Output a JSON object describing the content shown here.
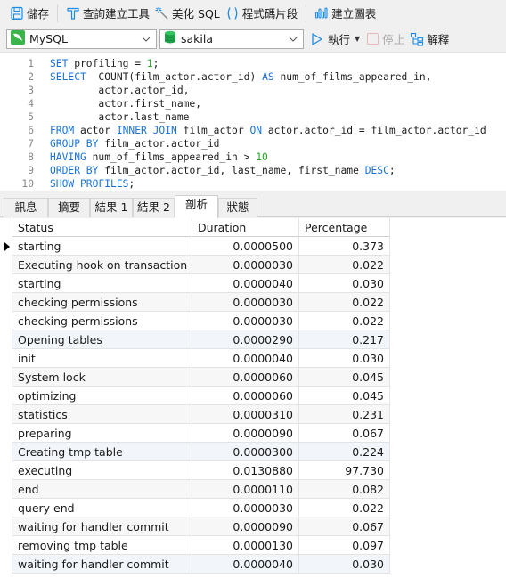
{
  "toolbar": {
    "save": {
      "label": "儲存",
      "icon": "floppy-disk-icon"
    },
    "query_builder": {
      "label": "查詢建立工具",
      "icon": "hammer-icon"
    },
    "beautify": {
      "label": "美化 SQL",
      "icon": "magic-wand-icon"
    },
    "snippet": {
      "label": "程式碼片段",
      "icon": "parentheses-icon"
    },
    "chart": {
      "label": "建立圖表",
      "icon": "chart-bars-icon"
    }
  },
  "toolbar2": {
    "connection": {
      "value": "MySQL",
      "icon": "mysql-dolphin-icon"
    },
    "database": {
      "value": "sakila",
      "icon": "database-icon"
    },
    "run": {
      "label": "執行",
      "icon": "play-icon"
    },
    "stop": {
      "label": "停止",
      "icon": "stop-icon"
    },
    "explain": {
      "label": "解釋",
      "icon": "explain-icon"
    }
  },
  "editor": {
    "lines": [
      {
        "n": "1",
        "tokens": [
          {
            "t": "SET",
            "k": "kw"
          },
          {
            "t": " profiling = "
          },
          {
            "t": "1",
            "k": "num"
          },
          {
            "t": ";"
          }
        ]
      },
      {
        "n": "2",
        "tokens": [
          {
            "t": "SELECT",
            "k": "kw"
          },
          {
            "t": "  COUNT(film_actor.actor_id) "
          },
          {
            "t": "AS",
            "k": "kw"
          },
          {
            "t": " num_of_films_appeared_in,"
          }
        ]
      },
      {
        "n": "3",
        "tokens": [
          {
            "t": "        actor.actor_id,"
          }
        ]
      },
      {
        "n": "4",
        "tokens": [
          {
            "t": "        actor.first_name,"
          }
        ]
      },
      {
        "n": "5",
        "tokens": [
          {
            "t": "        actor.last_name"
          }
        ]
      },
      {
        "n": "6",
        "tokens": [
          {
            "t": "FROM",
            "k": "kw"
          },
          {
            "t": " actor "
          },
          {
            "t": "INNER JOIN",
            "k": "kw"
          },
          {
            "t": " film_actor "
          },
          {
            "t": "ON",
            "k": "kw"
          },
          {
            "t": " actor.actor_id = film_actor.actor_id"
          }
        ]
      },
      {
        "n": "7",
        "tokens": [
          {
            "t": "GROUP BY",
            "k": "kw"
          },
          {
            "t": " film_actor.actor_id"
          }
        ]
      },
      {
        "n": "8",
        "tokens": [
          {
            "t": "HAVING",
            "k": "kw"
          },
          {
            "t": " num_of_films_appeared_in > "
          },
          {
            "t": "10",
            "k": "num"
          }
        ]
      },
      {
        "n": "9",
        "tokens": [
          {
            "t": "ORDER BY",
            "k": "kw"
          },
          {
            "t": " film_actor.actor_id, last_name, first_name "
          },
          {
            "t": "DESC",
            "k": "kw"
          },
          {
            "t": ";"
          }
        ]
      },
      {
        "n": "10",
        "tokens": [
          {
            "t": "SHOW PROFILES",
            "k": "kw"
          },
          {
            "t": ";"
          }
        ]
      }
    ]
  },
  "tabs": [
    {
      "label": "訊息",
      "active": false
    },
    {
      "label": "摘要",
      "active": false
    },
    {
      "label": "結果 1",
      "active": false
    },
    {
      "label": "結果 2",
      "active": false
    },
    {
      "label": "剖析",
      "active": true
    },
    {
      "label": "狀態",
      "active": false
    }
  ],
  "grid": {
    "columns": [
      "Status",
      "Duration",
      "Percentage"
    ],
    "rows": [
      {
        "status": "starting",
        "duration": "0.0000500",
        "percentage": "0.373",
        "current": true
      },
      {
        "status": "Executing hook on transaction",
        "duration": "0.0000030",
        "percentage": "0.022"
      },
      {
        "status": "starting",
        "duration": "0.0000040",
        "percentage": "0.030"
      },
      {
        "status": "checking permissions",
        "duration": "0.0000030",
        "percentage": "0.022"
      },
      {
        "status": "checking permissions",
        "duration": "0.0000030",
        "percentage": "0.022"
      },
      {
        "status": "Opening tables",
        "duration": "0.0000290",
        "percentage": "0.217"
      },
      {
        "status": "init",
        "duration": "0.0000040",
        "percentage": "0.030"
      },
      {
        "status": "System lock",
        "duration": "0.0000060",
        "percentage": "0.045"
      },
      {
        "status": "optimizing",
        "duration": "0.0000060",
        "percentage": "0.045"
      },
      {
        "status": "statistics",
        "duration": "0.0000310",
        "percentage": "0.231"
      },
      {
        "status": "preparing",
        "duration": "0.0000090",
        "percentage": "0.067"
      },
      {
        "status": "Creating tmp table",
        "duration": "0.0000300",
        "percentage": "0.224"
      },
      {
        "status": "executing",
        "duration": "0.0130880",
        "percentage": "97.730"
      },
      {
        "status": "end",
        "duration": "0.0000110",
        "percentage": "0.082"
      },
      {
        "status": "query end",
        "duration": "0.0000030",
        "percentage": "0.022"
      },
      {
        "status": "waiting for handler commit",
        "duration": "0.0000090",
        "percentage": "0.067"
      },
      {
        "status": "removing tmp table",
        "duration": "0.0000130",
        "percentage": "0.097"
      },
      {
        "status": "waiting for handler commit",
        "duration": "0.0000040",
        "percentage": "0.030"
      }
    ]
  },
  "colors": {
    "keyword": "#1a73d9",
    "number": "#22aa22",
    "accent": "#1a8ce8",
    "mysql_green": "#3cb44b"
  }
}
